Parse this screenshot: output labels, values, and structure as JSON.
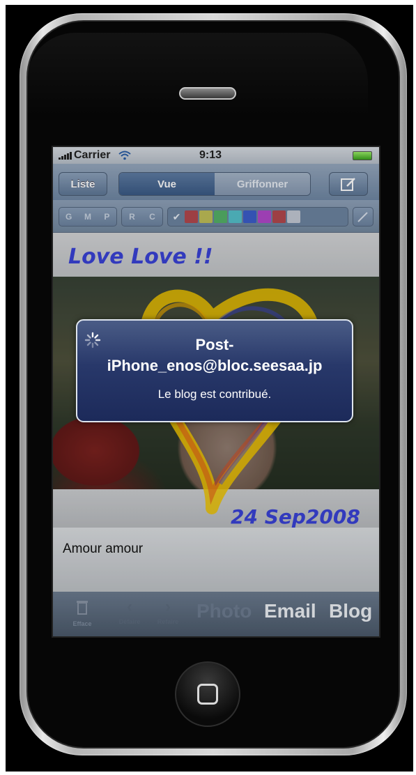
{
  "statusbar": {
    "carrier": "Carrier",
    "time": "9:13"
  },
  "navbar": {
    "list_button": "Liste",
    "segments": [
      "Vue",
      "Griffonner"
    ],
    "selected_segment": "Vue",
    "compose_icon": "compose-icon"
  },
  "drawing_toolbar": {
    "style_buttons": [
      "G",
      "M",
      "P"
    ],
    "rc_buttons": [
      "R",
      "C"
    ],
    "colors": [
      "#c43a3a",
      "#d6cf46",
      "#4fbe5a",
      "#4fd1d6",
      "#2f55d6",
      "#c33ad6",
      "#c43a3a",
      "#d9dce2"
    ]
  },
  "canvas": {
    "handwriting_top": "Love Love !!",
    "handwriting_bottom": "24 Sep2008",
    "colors": {
      "ink": "#3a43d8",
      "heart": "#f0c400"
    }
  },
  "alert": {
    "title_line1": "Post-",
    "title_line2": "iPhone_enos@bloc.seesaa.jp",
    "message": "Le blog est contribué."
  },
  "note": {
    "text": "Amour amour"
  },
  "bottombar": {
    "trash_label": "Efface",
    "undo_label": "Défaire",
    "redo_label": "Refaire",
    "photo": "Photo",
    "email": "Email",
    "blog": "Blog"
  }
}
